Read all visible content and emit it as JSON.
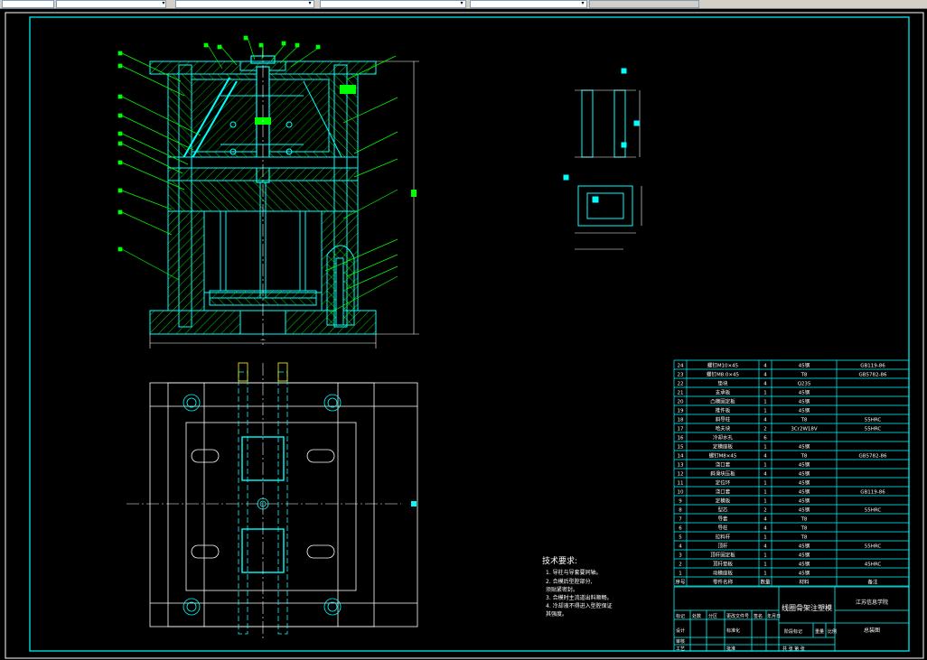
{
  "toolbar": {
    "fields": [
      "",
      "",
      "",
      "",
      ""
    ],
    "dropdown_icon": "chevron-down-icon"
  },
  "colors": {
    "background": "#000000",
    "frame": "#ffffff",
    "border": "#00ffff",
    "part": "#00ffff",
    "hatch": "#00ff00",
    "leader": "#00ff00",
    "centerline": "#ffffff",
    "text": "#ffffff",
    "dim": "#00ffff"
  },
  "drawing": {
    "dim_label": "---",
    "technical_requirements": {
      "title": "技术要求:",
      "items": [
        "1. 导柱与导套要同轴。",
        "2. 合模后型腔部分,",
        "   须贴紧密封。",
        "3. 合模时主流道出料顺畅。",
        "4. 冷却液不得进入型腔保证",
        "   其强度。"
      ]
    },
    "parts_list": [
      {
        "no": "24",
        "name": "螺钉M10×45",
        "qty": "4",
        "material": "45钢",
        "note": "GB119-86"
      },
      {
        "no": "23",
        "name": "螺钉M8.0×45",
        "qty": "4",
        "material": "T8",
        "note": "GB5782-86"
      },
      {
        "no": "22",
        "name": "垫块",
        "qty": "4",
        "material": "Q235",
        "note": ""
      },
      {
        "no": "21",
        "name": "支承板",
        "qty": "1",
        "material": "45钢",
        "note": ""
      },
      {
        "no": "20",
        "name": "凸模固定板",
        "qty": "1",
        "material": "45钢",
        "note": ""
      },
      {
        "no": "19",
        "name": "推件板",
        "qty": "1",
        "material": "45钢",
        "note": ""
      },
      {
        "no": "18",
        "name": "斜导柱",
        "qty": "4",
        "material": "T8",
        "note": "55HRC"
      },
      {
        "no": "17",
        "name": "哈夫块",
        "qty": "2",
        "material": "3Cr2W18V",
        "note": "55HRC"
      },
      {
        "no": "16",
        "name": "冷却水孔",
        "qty": "6",
        "material": "",
        "note": ""
      },
      {
        "no": "15",
        "name": "定模座板",
        "qty": "1",
        "material": "45钢",
        "note": ""
      },
      {
        "no": "14",
        "name": "螺钉M8×45",
        "qty": "4",
        "material": "T8",
        "note": "GB5782-86"
      },
      {
        "no": "13",
        "name": "浇口套",
        "qty": "1",
        "material": "45钢",
        "note": ""
      },
      {
        "no": "12",
        "name": "斜滑块压板",
        "qty": "4",
        "material": "45钢",
        "note": ""
      },
      {
        "no": "11",
        "name": "定位环",
        "qty": "1",
        "material": "45钢",
        "note": ""
      },
      {
        "no": "10",
        "name": "浇口套",
        "qty": "1",
        "material": "45钢",
        "note": "GB119-86"
      },
      {
        "no": "9",
        "name": "定模板",
        "qty": "1",
        "material": "45钢",
        "note": ""
      },
      {
        "no": "8",
        "name": "型芯",
        "qty": "2",
        "material": "45钢",
        "note": "55HRC"
      },
      {
        "no": "7",
        "name": "导套",
        "qty": "4",
        "material": "T8",
        "note": ""
      },
      {
        "no": "6",
        "name": "导柱",
        "qty": "4",
        "material": "T8",
        "note": ""
      },
      {
        "no": "5",
        "name": "拉料杆",
        "qty": "1",
        "material": "T8",
        "note": ""
      },
      {
        "no": "4",
        "name": "顶杆",
        "qty": "4",
        "material": "45钢",
        "note": "55HRC"
      },
      {
        "no": "3",
        "name": "顶杆固定板",
        "qty": "1",
        "material": "45钢",
        "note": ""
      },
      {
        "no": "2",
        "name": "顶杆垫板",
        "qty": "1",
        "material": "45钢",
        "note": "45HRC"
      },
      {
        "no": "1",
        "name": "动模座板",
        "qty": "1",
        "material": "45钢",
        "note": ""
      }
    ],
    "parts_header": {
      "no": "序号",
      "name": "零件名称",
      "qty": "数量",
      "material": "材料",
      "note": "备注"
    },
    "title_block": {
      "drawing_title": "线圈骨架注塑模",
      "school": "江苏信息学院",
      "sheet": "总装图",
      "row_labels": [
        "标记",
        "处数",
        "分区",
        "更改文件号",
        "签名",
        "年月日"
      ],
      "design_labels": [
        "设计",
        "标准化"
      ],
      "stage_labels": [
        "阶段标记",
        "重量",
        "比例"
      ],
      "review_label": "审核",
      "process_label": "工艺",
      "approve_label": "批准",
      "sheet_count": "共   张   第   张"
    }
  }
}
